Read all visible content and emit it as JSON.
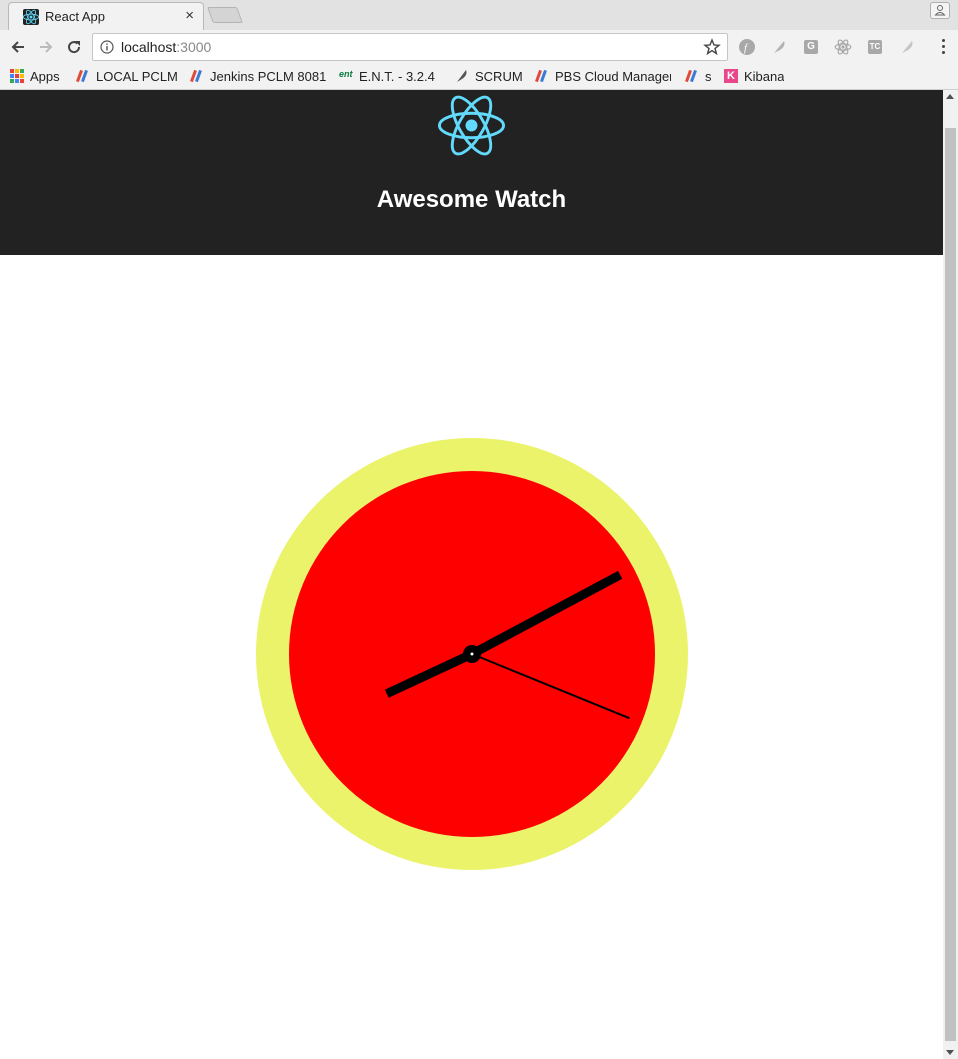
{
  "browser": {
    "tab": {
      "title": "React App",
      "close_glyph": "×"
    },
    "address": {
      "host": "localhost",
      "port": ":3000"
    },
    "bookmarks": [
      {
        "label": "Apps",
        "icon": "apps-grid-icon"
      },
      {
        "label": "LOCAL PCLM",
        "icon": "jenkins-icon"
      },
      {
        "label": "Jenkins PCLM 8081",
        "icon": "jenkins-icon"
      },
      {
        "label": "E.N.T. - 3.2.4",
        "icon": "ent-icon"
      },
      {
        "label": "SCRUM",
        "icon": "feather-icon"
      },
      {
        "label": "PBS Cloud Manager",
        "icon": "jenkins-icon"
      },
      {
        "label": "s",
        "icon": "jenkins-icon"
      },
      {
        "label": "Kibana",
        "icon": "kibana-icon"
      }
    ],
    "extensions": [
      {
        "name": "fedora-icon",
        "glyph": "ƒ"
      },
      {
        "name": "feather-icon",
        "glyph": ""
      },
      {
        "name": "g-extension-icon",
        "glyph": "G"
      },
      {
        "name": "react-devtools-icon",
        "glyph": ""
      },
      {
        "name": "tc-extension-icon",
        "glyph": "TC"
      },
      {
        "name": "feather-alt-icon",
        "glyph": ""
      }
    ]
  },
  "app": {
    "title": "Awesome Watch",
    "logo_color": "#61dafb",
    "header_color": "#222222"
  },
  "watch": {
    "time": {
      "hours": 8,
      "minutes": 10,
      "seconds": 18.7
    },
    "ring_color": "#ebf36a",
    "face_color": "#ff0000",
    "hand_color": "#000000"
  }
}
